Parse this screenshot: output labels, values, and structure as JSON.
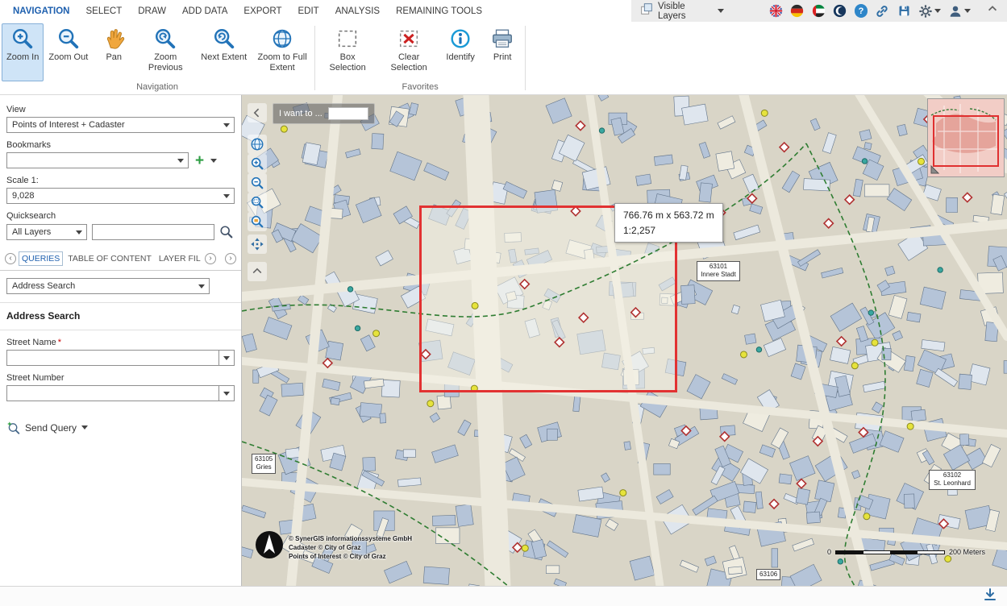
{
  "menubar": {
    "tabs": [
      {
        "label": "NAVIGATION"
      },
      {
        "label": "SELECT"
      },
      {
        "label": "DRAW"
      },
      {
        "label": "ADD DATA"
      },
      {
        "label": "EXPORT"
      },
      {
        "label": "EDIT"
      },
      {
        "label": "ANALYSIS"
      },
      {
        "label": "REMAINING TOOLS"
      }
    ],
    "visible_layers_label": "Visible Layers"
  },
  "ribbon": {
    "groups": [
      {
        "label": "Navigation",
        "tools": [
          {
            "label": "Zoom In"
          },
          {
            "label": "Zoom Out"
          },
          {
            "label": "Pan"
          },
          {
            "label": "Zoom Previous"
          },
          {
            "label": "Next Extent"
          },
          {
            "label": "Zoom to Full Extent"
          }
        ]
      },
      {
        "label": "Favorites",
        "tools": [
          {
            "label": "Box Selection"
          },
          {
            "label": "Clear Selection"
          },
          {
            "label": "Identify"
          },
          {
            "label": "Print"
          }
        ]
      }
    ]
  },
  "sidebar": {
    "view_label": "View",
    "view_value": "Points of Interest + Cadaster",
    "bookmarks_label": "Bookmarks",
    "scale_label": "Scale 1:",
    "scale_value": "9,028",
    "quicksearch_label": "Quicksearch",
    "quicksearch_layer_value": "All Layers",
    "tabs": [
      {
        "label": "QUERIES"
      },
      {
        "label": "TABLE OF CONTENT"
      },
      {
        "label": "LAYER FIL"
      }
    ],
    "query_type_value": "Address Search",
    "section_title": "Address Search",
    "street_name_label": "Street Name",
    "required_marker": "*",
    "street_number_label": "Street Number",
    "send_query_label": "Send Query"
  },
  "map": {
    "i_want_to_label": "I want to ...",
    "measure_tooltip": {
      "size": "766.76 m x 563.72 m",
      "scale": "1:2,257"
    },
    "district_labels": [
      {
        "code": "63101",
        "name": "Innere Stadt"
      },
      {
        "code": "63105",
        "name": "Gries"
      },
      {
        "code": "63102",
        "name": "St. Leonhard"
      },
      {
        "code": "63106",
        "name": ""
      }
    ],
    "copyright_lines": [
      "© SynerGIS informationssysteme GmbH",
      "Cadaster © City of Graz",
      "Points of Interest © City of Graz"
    ],
    "scalebar": {
      "zero": "0",
      "end": "200 Meters"
    }
  },
  "icons": {
    "help_glyph": "?",
    "add_bookmark_glyph": "+",
    "tab_prev_glyph": "‹",
    "tab_next_glyph": "›",
    "tab_more_glyph": "›"
  },
  "colors": {
    "accent_blue": "#1d6fb5",
    "active_tab_blue": "#1d5fae",
    "selection_red": "#e23232",
    "map_background": "#d9d5c7",
    "building_fill": "#b5c4d8",
    "active_tool_background": "#cfe4f7"
  }
}
